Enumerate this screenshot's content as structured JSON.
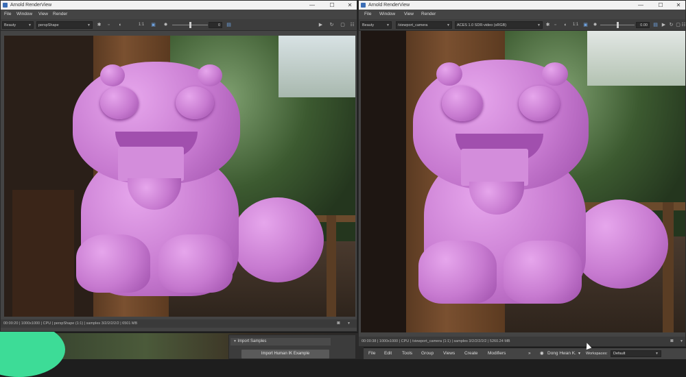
{
  "left_window": {
    "title": "Arnold RenderView",
    "controls": {
      "minimize": "—",
      "maximize": "☐",
      "close": "✕"
    },
    "menu": [
      "File",
      "Window",
      "View",
      "Render"
    ],
    "toolbar": {
      "aov": "Beauty",
      "camera": "perspShape",
      "ratio": "1:1",
      "exposure": "0"
    },
    "status": "00:00:20 | 1000x1000 | CPU | perspShape (1:1) | samples 3/2/2/2/2/2 | 6501 MB"
  },
  "right_window": {
    "title": "Arnold RenderView",
    "controls": {
      "minimize": "—",
      "maximize": "☐",
      "close": "✕"
    },
    "menu": [
      "File",
      "Window",
      "View",
      "Render"
    ],
    "toolbar": {
      "aov": "Beauty",
      "camera": "/viewport_camera",
      "view_transform": "ACES 1.0 SDR-video (sRGB)",
      "ratio": "1:1",
      "exposure": "0.00"
    },
    "status": "00:00:38 | 1000x1000 | CPU | /viewport_camera (1:1) | samples 3/2/2/2/2/2 | 5260.24 MB"
  },
  "background_panel": {
    "section_label": "Import Samples",
    "button_label": "Import Human IK Example"
  },
  "maya_menubar": {
    "items": [
      "File",
      "Edit",
      "Tools",
      "Group",
      "Views",
      "Create",
      "Modifiers"
    ],
    "overflow": "»",
    "user": "Dong Hwan K.",
    "workspaces_label": "Workspaces:",
    "workspace": "Default"
  },
  "colors": {
    "accent_green": "#3ddc97",
    "render_pink": "#cf82d8"
  }
}
